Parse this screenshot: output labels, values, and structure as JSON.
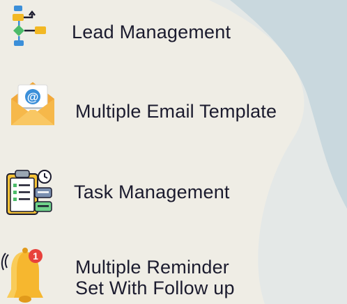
{
  "features": [
    {
      "icon": "flowchart-icon",
      "label": "Lead Management"
    },
    {
      "icon": "email-envelope-icon",
      "label": "Multiple Email Template"
    },
    {
      "icon": "task-clipboard-icon",
      "label": "Task Management"
    },
    {
      "icon": "notification-bell-icon",
      "badge": "1",
      "label_line1": "Multiple Reminder",
      "label_line2": "Set With Follow up"
    }
  ],
  "colors": {
    "background": "#efede5",
    "shape_light": "#e4e8e7",
    "shape_blue": "#c9d8de",
    "text": "#1b1b2e"
  }
}
